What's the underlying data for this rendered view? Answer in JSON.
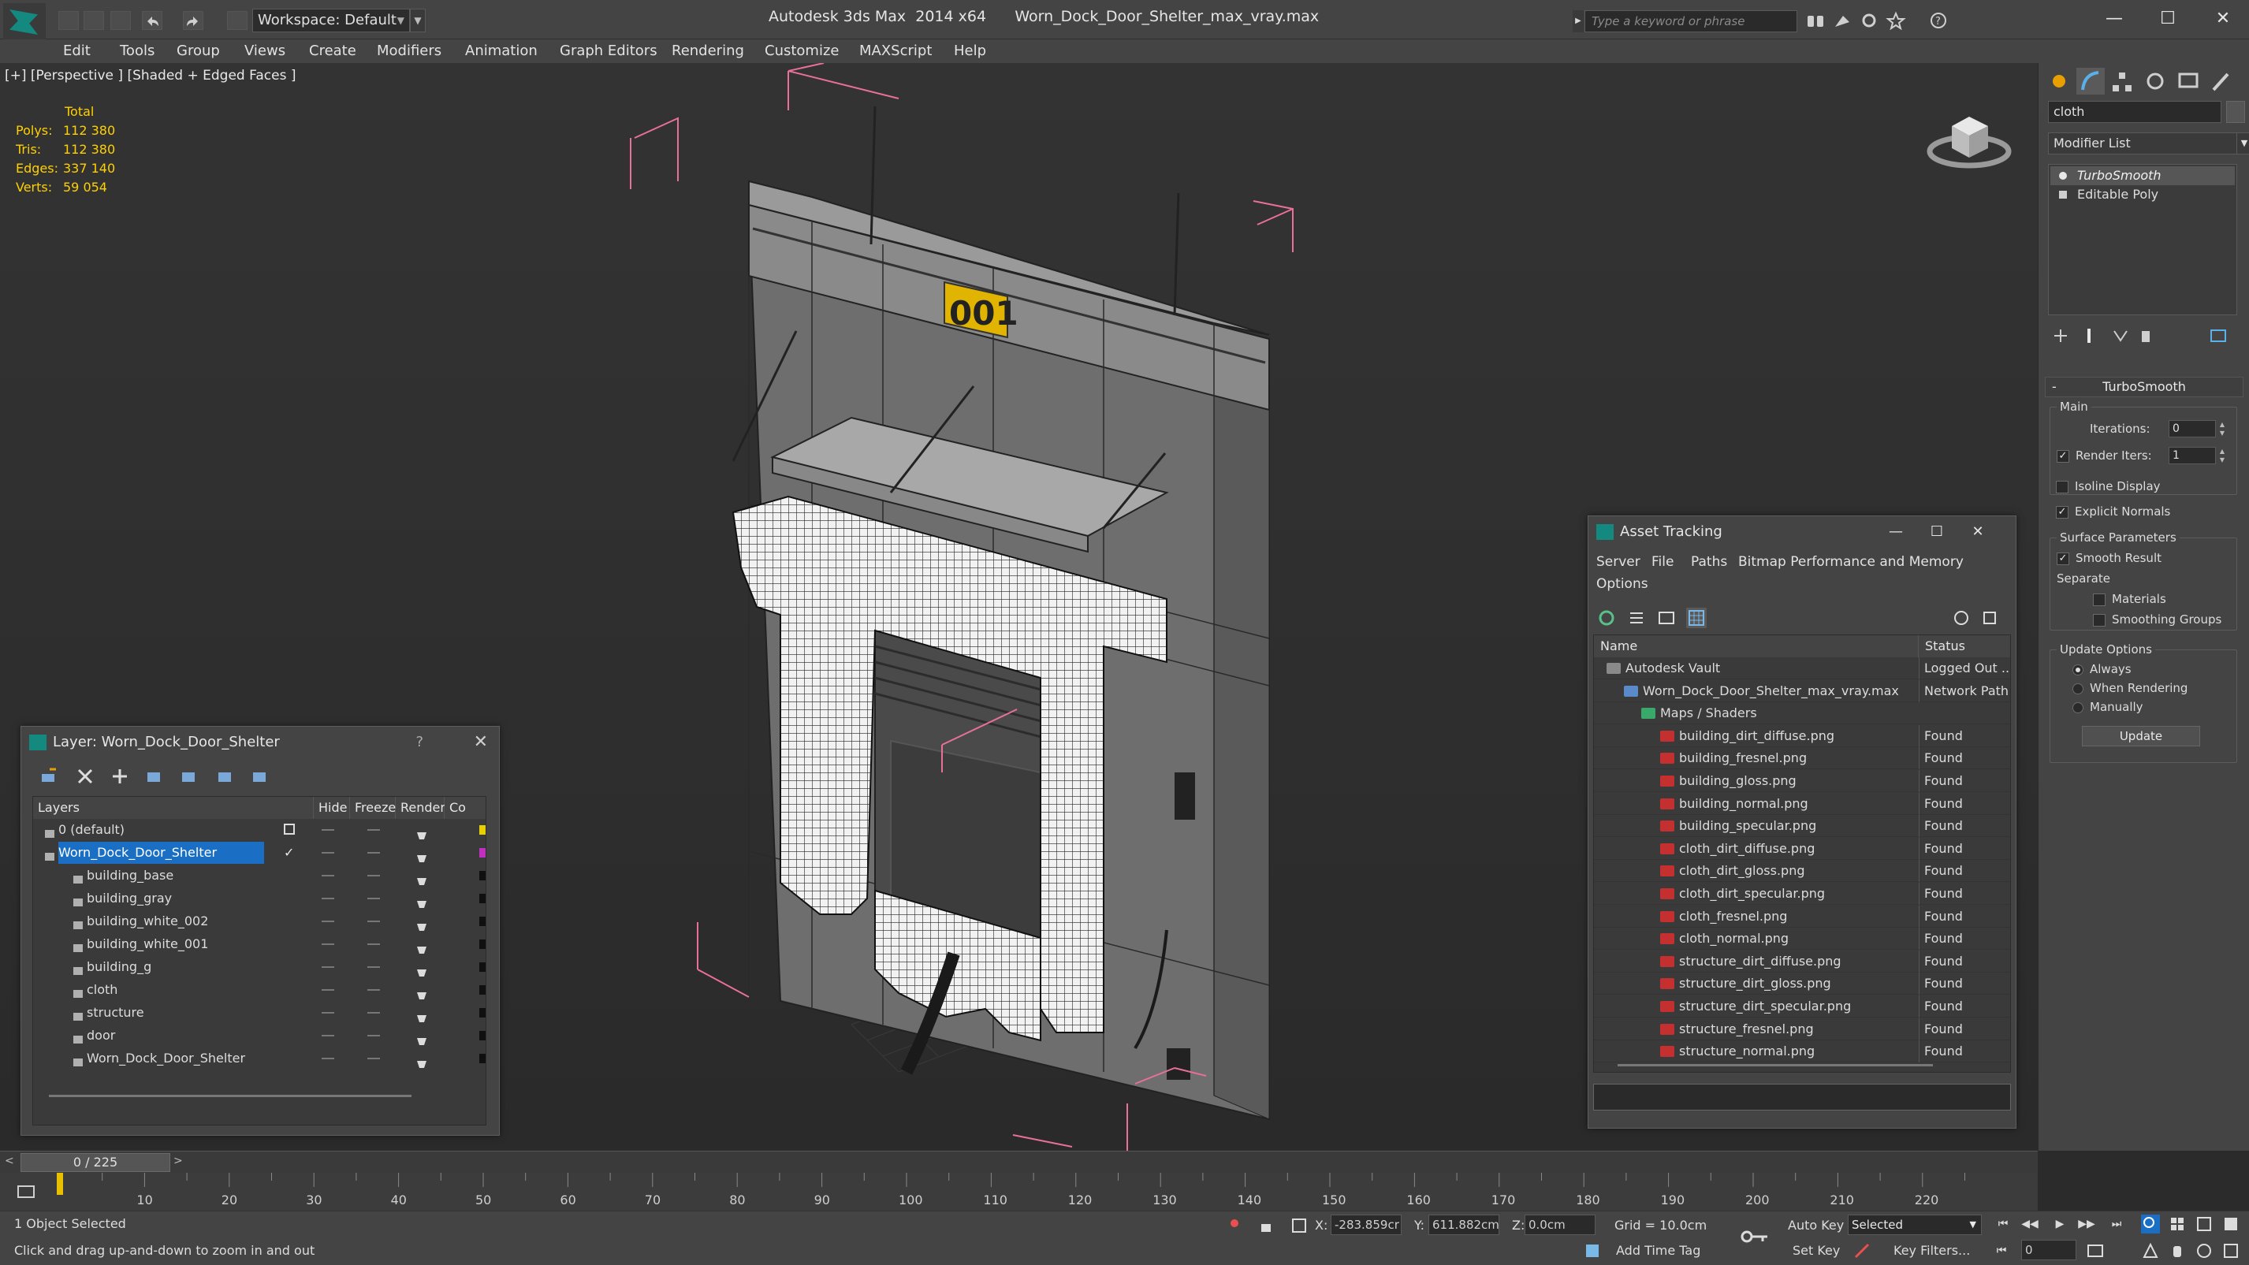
{
  "titlebar": {
    "app_title": "Autodesk 3ds Max  2014 x64",
    "file_title": "Worn_Dock_Door_Shelter_max_vray.max",
    "workspace_label": "Workspace: Default",
    "search_placeholder": "Type a keyword or phrase"
  },
  "menu": [
    "Edit",
    "Tools",
    "Group",
    "Views",
    "Create",
    "Modifiers",
    "Animation",
    "Graph Editors",
    "Rendering",
    "Customize",
    "MAXScript",
    "Help"
  ],
  "viewport": {
    "label": "[+] [Perspective ] [Shaded + Edged Faces ]",
    "stats_header": "Total",
    "stats": [
      {
        "key": "Polys:",
        "value": "112 380"
      },
      {
        "key": "Tris:",
        "value": "112 380"
      },
      {
        "key": "Edges:",
        "value": "337 140"
      },
      {
        "key": "Verts:",
        "value": "59 054"
      }
    ],
    "sign_text": "001"
  },
  "command_panel": {
    "object_name": "cloth",
    "modifier_list": "Modifier List",
    "stack": [
      "TurboSmooth",
      "Editable Poly"
    ],
    "rollout_title": "TurboSmooth",
    "main_group": "Main",
    "iterations_label": "Iterations:",
    "iterations_value": "0",
    "render_iters_label": "Render Iters:",
    "render_iters_value": "1",
    "isoline_label": "Isoline Display",
    "explicit_normals_label": "Explicit Normals",
    "surface_group": "Surface Parameters",
    "smooth_result_label": "Smooth Result",
    "separate_label": "Separate",
    "materials_label": "Materials",
    "smoothing_groups_label": "Smoothing Groups",
    "update_group": "Update Options",
    "always_label": "Always",
    "when_rendering_label": "When Rendering",
    "manually_label": "Manually",
    "update_button": "Update",
    "checks": {
      "render_iters": true,
      "isoline": false,
      "explicit_normals": true,
      "smooth_result": true,
      "materials": false,
      "smoothing_groups": false
    }
  },
  "layer_dialog": {
    "title": "Layer: Worn_Dock_Door_Shelter",
    "help": "?",
    "columns": [
      "Layers",
      "Hide",
      "Freeze",
      "Render",
      "Co"
    ],
    "rows": [
      {
        "name": "0 (default)",
        "level": 0,
        "color": "#e8d000"
      },
      {
        "name": "Worn_Dock_Door_Shelter",
        "level": 0,
        "selected": true,
        "color": "#c030c0"
      },
      {
        "name": "building_base",
        "level": 1,
        "color": "#101010"
      },
      {
        "name": "building_gray",
        "level": 1,
        "color": "#101010"
      },
      {
        "name": "building_white_002",
        "level": 1,
        "color": "#101010"
      },
      {
        "name": "building_white_001",
        "level": 1,
        "color": "#101010"
      },
      {
        "name": "building_g",
        "level": 1,
        "color": "#101010"
      },
      {
        "name": "cloth",
        "level": 1,
        "color": "#101010"
      },
      {
        "name": "structure",
        "level": 1,
        "color": "#101010"
      },
      {
        "name": "door",
        "level": 1,
        "color": "#101010"
      },
      {
        "name": "Worn_Dock_Door_Shelter",
        "level": 1,
        "color": "#101010"
      }
    ]
  },
  "asset_dialog": {
    "title": "Asset Tracking",
    "menu": [
      "Server",
      "File",
      "Paths",
      "Bitmap Performance and Memory",
      "Options"
    ],
    "columns": [
      "Name",
      "Status"
    ],
    "rows": [
      {
        "name": "Autodesk Vault",
        "status": "Logged Out ...",
        "level": 0
      },
      {
        "name": "Worn_Dock_Door_Shelter_max_vray.max",
        "status": "Network Path",
        "level": 1
      },
      {
        "name": "Maps / Shaders",
        "status": "",
        "level": 2
      },
      {
        "name": "building_dirt_diffuse.png",
        "status": "Found",
        "level": 3
      },
      {
        "name": "building_fresnel.png",
        "status": "Found",
        "level": 3
      },
      {
        "name": "building_gloss.png",
        "status": "Found",
        "level": 3
      },
      {
        "name": "building_normal.png",
        "status": "Found",
        "level": 3
      },
      {
        "name": "building_specular.png",
        "status": "Found",
        "level": 3
      },
      {
        "name": "cloth_dirt_diffuse.png",
        "status": "Found",
        "level": 3
      },
      {
        "name": "cloth_dirt_gloss.png",
        "status": "Found",
        "level": 3
      },
      {
        "name": "cloth_dirt_specular.png",
        "status": "Found",
        "level": 3
      },
      {
        "name": "cloth_fresnel.png",
        "status": "Found",
        "level": 3
      },
      {
        "name": "cloth_normal.png",
        "status": "Found",
        "level": 3
      },
      {
        "name": "structure_dirt_diffuse.png",
        "status": "Found",
        "level": 3
      },
      {
        "name": "structure_dirt_gloss.png",
        "status": "Found",
        "level": 3
      },
      {
        "name": "structure_dirt_specular.png",
        "status": "Found",
        "level": 3
      },
      {
        "name": "structure_fresnel.png",
        "status": "Found",
        "level": 3
      },
      {
        "name": "structure_normal.png",
        "status": "Found",
        "level": 3
      }
    ]
  },
  "timeline": {
    "frame_label": "0 / 225",
    "ticks": [
      "10",
      "20",
      "30",
      "40",
      "50",
      "60",
      "70",
      "80",
      "90",
      "100",
      "110",
      "120",
      "130",
      "140",
      "150",
      "160",
      "170",
      "180",
      "190",
      "200",
      "210",
      "220"
    ]
  },
  "status": {
    "selection": "1 Object Selected",
    "prompt": "Click and drag up-and-down to zoom in and out",
    "x_label": "X:",
    "x_value": "-283.859cr",
    "y_label": "Y:",
    "y_value": "611.882cm",
    "z_label": "Z:",
    "z_value": "0.0cm",
    "grid": "Grid = 10.0cm",
    "auto_key": "Auto Key",
    "selected_set": "Selected",
    "set_key": "Set Key",
    "key_filters": "Key Filters...",
    "add_time_tag": "Add Time Tag",
    "frame_value": "0"
  },
  "colors": {
    "accent": "#1a6fc4",
    "stats_yellow": "#ffd000",
    "bbox_pink": "#e8709a",
    "png_red": "#c43030"
  }
}
